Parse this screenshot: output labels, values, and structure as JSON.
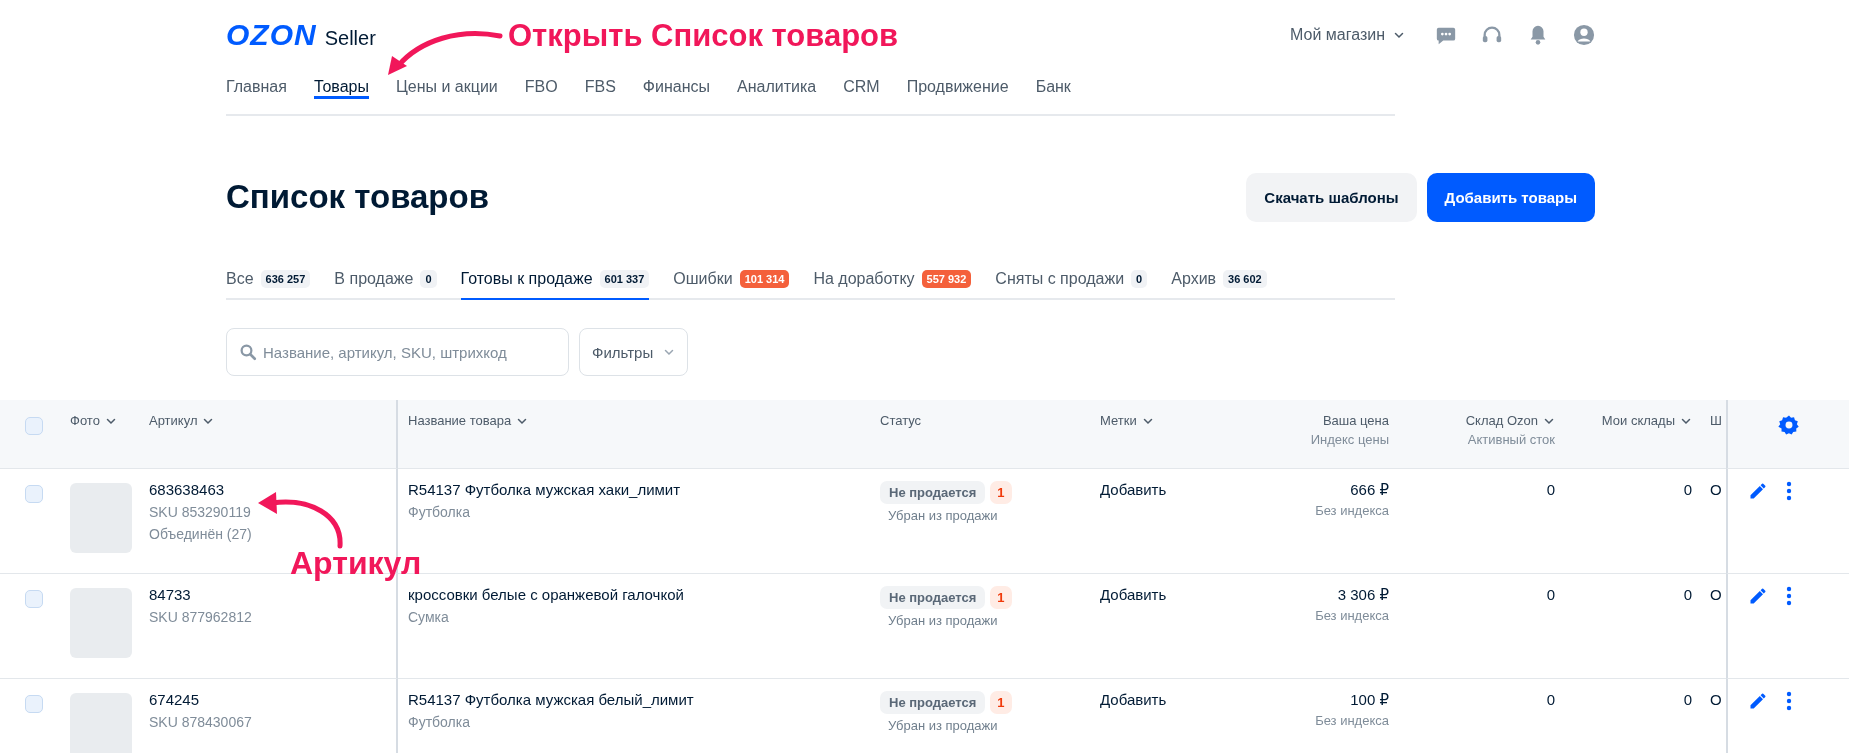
{
  "header": {
    "logo": "OZON",
    "logo_suffix": "Seller",
    "store": "Мой магазин"
  },
  "nav": [
    {
      "label": "Главная",
      "selected": false
    },
    {
      "label": "Товары",
      "selected": true
    },
    {
      "label": "Цены и акции",
      "selected": false
    },
    {
      "label": "FBO",
      "selected": false
    },
    {
      "label": "FBS",
      "selected": false
    },
    {
      "label": "Финансы",
      "selected": false
    },
    {
      "label": "Аналитика",
      "selected": false
    },
    {
      "label": "CRM",
      "selected": false
    },
    {
      "label": "Продвижение",
      "selected": false
    },
    {
      "label": "Банк",
      "selected": false
    }
  ],
  "page": {
    "title": "Список товаров",
    "buttons": [
      {
        "label": "Скачать шаблоны",
        "kind": "secondary"
      },
      {
        "label": "Добавить товары",
        "kind": "primary"
      }
    ]
  },
  "tabs": [
    {
      "label": "Все",
      "count": "636 257",
      "kind": "neutral",
      "selected": false
    },
    {
      "label": "В продаже",
      "count": "0",
      "kind": "neutral",
      "selected": false
    },
    {
      "label": "Готовы к продаже",
      "count": "601 337",
      "kind": "neutral",
      "selected": true
    },
    {
      "label": "Ошибки",
      "count": "101 314",
      "kind": "alert",
      "selected": false
    },
    {
      "label": "На доработку",
      "count": "557 932",
      "kind": "alert",
      "selected": false
    },
    {
      "label": "Сняты с продажи",
      "count": "0",
      "kind": "neutral",
      "selected": false
    },
    {
      "label": "Архив",
      "count": "36 602",
      "kind": "neutral",
      "selected": false
    }
  ],
  "search": {
    "placeholder": "Название, артикул, SKU, штрихкод"
  },
  "filters": {
    "label": "Фильтры"
  },
  "table": {
    "select_all": {
      "checked": false
    },
    "columns": [
      {
        "label": "Фото",
        "sortable": true
      },
      {
        "label": "Артикул",
        "sortable": true
      },
      {
        "label": "Название товара",
        "sortable": true
      },
      {
        "label": "Статус",
        "sortable": false
      },
      {
        "label": "Метки",
        "sortable": true
      },
      {
        "label": "Ваша цена",
        "sub": "Индекс цены",
        "sortable": false
      },
      {
        "label": "Склад Ozon",
        "sub": "Активный сток",
        "sortable": true
      },
      {
        "label": "Мои склады",
        "sortable": true
      },
      {
        "label": "Ш",
        "sortable": false
      }
    ],
    "rows": [
      {
        "checked": false,
        "article": "683638463",
        "sku": "SKU 853290119",
        "merged": "Объединён (27)",
        "name": "R54137 Футболка мужская хаки_лимит",
        "category": "Футболка",
        "status": "Не продается",
        "status_count": "1",
        "status_note": "Убран из продажи",
        "labels": "Добавить",
        "price": "666 ₽",
        "price_index": "Без индекса",
        "stock_ozon": "0",
        "stock_mine": "0",
        "column_8": "О"
      },
      {
        "checked": false,
        "article": "84733",
        "sku": "SKU 877962812",
        "name": "кроссовки белые с оранжевой галочкой",
        "category": "Сумка",
        "status": "Не продается",
        "status_count": "1",
        "status_note": "Убран из продажи",
        "labels": "Добавить",
        "price": "3 306 ₽",
        "price_index": "Без индекса",
        "stock_ozon": "0",
        "stock_mine": "0",
        "column_8": "О"
      },
      {
        "checked": false,
        "article": "674245",
        "sku": "SKU 878430067",
        "name": "R54137 Футболка мужская белый_лимит",
        "category": "Футболка",
        "status": "Не продается",
        "status_count": "1",
        "status_note": "Убран из продажи",
        "labels": "Добавить",
        "price": "100 ₽",
        "price_index": "Без индекса",
        "stock_ozon": "0",
        "stock_mine": "0",
        "column_8": "О"
      }
    ]
  },
  "annotations": [
    {
      "text": "Открыть Список товаров"
    },
    {
      "text": "Артикул"
    }
  ]
}
